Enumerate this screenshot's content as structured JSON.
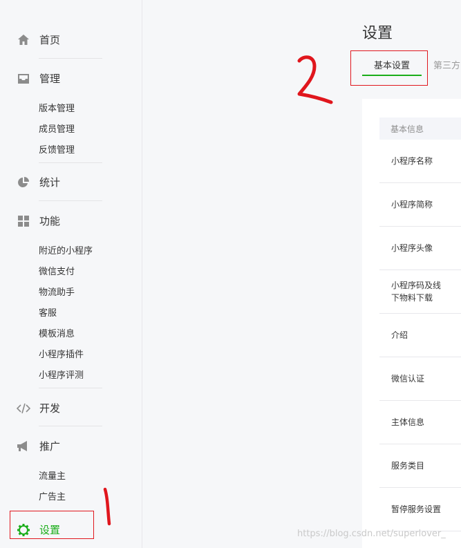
{
  "sidebar": {
    "home": {
      "label": "首页",
      "icon": "home-icon"
    },
    "manage": {
      "label": "管理",
      "icon": "inbox-icon",
      "items": [
        "版本管理",
        "成员管理",
        "反馈管理"
      ]
    },
    "stats": {
      "label": "统计",
      "icon": "pie-chart-icon"
    },
    "features": {
      "label": "功能",
      "icon": "grid-icon",
      "items": [
        "附近的小程序",
        "微信支付",
        "物流助手",
        "客服",
        "模板消息",
        "小程序插件",
        "小程序评测"
      ]
    },
    "dev": {
      "label": "开发",
      "icon": "code-icon"
    },
    "promote": {
      "label": "推广",
      "icon": "megaphone-icon",
      "items": [
        "流量主",
        "广告主"
      ]
    },
    "settings": {
      "label": "设置",
      "icon": "gear-icon",
      "active": true
    }
  },
  "main": {
    "title": "设置",
    "tabs": [
      {
        "label": "基本设置",
        "active": true
      },
      {
        "label": "第三方"
      }
    ],
    "section_header": "基本信息",
    "rows": [
      "小程序名称",
      "小程序简称",
      "小程序头像",
      "小程序码及线下物料下载",
      "介绍",
      "微信认证",
      "主体信息",
      "服务类目",
      "暂停服务设置"
    ]
  },
  "watermark": "https://blog.csdn.net/superlover_",
  "colors": {
    "accent": "#1aad19",
    "annotation": "#e0161d"
  }
}
